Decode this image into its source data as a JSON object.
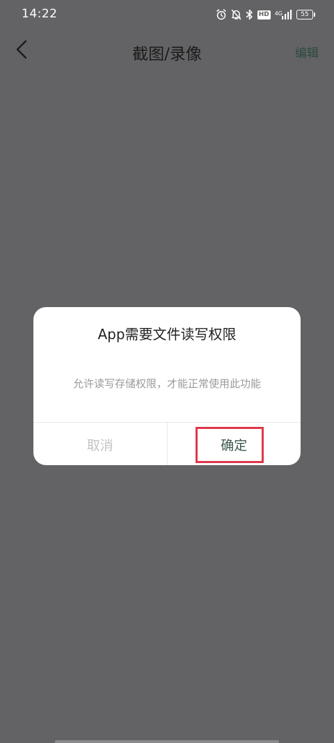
{
  "status_bar": {
    "time": "14:22",
    "hd_label": "HD",
    "network_label": "4G",
    "battery_level": "55",
    "icons": [
      "alarm-icon",
      "bell-muted-icon",
      "bluetooth-icon",
      "hd-icon",
      "signal-icon",
      "battery-icon"
    ]
  },
  "header": {
    "back_icon": "chevron-left-icon",
    "title": "截图/录像",
    "edit_label": "编辑"
  },
  "dialog": {
    "title": "App需要文件读写权限",
    "message": "允许读写存储权限，才能正常使用此功能",
    "cancel_label": "取消",
    "confirm_label": "确定",
    "highlight_color": "#e0364a"
  },
  "colors": {
    "overlay": "#636365",
    "dialog_bg": "#ffffff",
    "confirm_text": "#3b5a4f",
    "cancel_text": "#c4c4c4"
  }
}
